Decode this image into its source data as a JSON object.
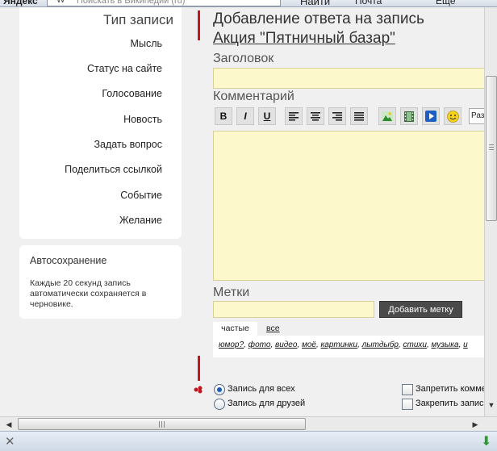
{
  "browser": {
    "logo": "Яндекс",
    "search_placeholder": "Поискать в Википедии (ru)",
    "find_label": "Найти",
    "mail_label": "Почта",
    "extra_label": "Ещё"
  },
  "sidebar": {
    "title": "Тип записи",
    "items": [
      {
        "label": "Мысль"
      },
      {
        "label": "Статус на сайте"
      },
      {
        "label": "Голосование"
      },
      {
        "label": "Новость"
      },
      {
        "label": "Задать вопрос"
      },
      {
        "label": "Поделиться ссылкой"
      },
      {
        "label": "Событие"
      },
      {
        "label": "Желание"
      }
    ]
  },
  "autosave": {
    "title": "Автосохранение",
    "description": "Каждые 20 секунд запись автоматически сохраняется в черновике."
  },
  "form": {
    "heading": "Добавление ответа на запись",
    "subheading": "Акция \"Пятничный базар\"",
    "title_label": "Заголовок",
    "title_value": "",
    "comment_label": "Комментарий",
    "comment_value": "",
    "format_select_value": "Разм",
    "toolbar": {
      "bold": "B",
      "italic": "I",
      "underline": "U"
    },
    "tags_label": "Метки",
    "tags_value": "",
    "add_tag_button": "Добавить метку",
    "tag_tabs": {
      "frequent": "частые",
      "all": "все"
    },
    "tag_cloud": [
      "юмор?",
      "фото",
      "видео",
      "моё",
      "картинки",
      "лытдыбр",
      "стихи",
      "музыка",
      "и"
    ]
  },
  "privacy": {
    "options": [
      {
        "label": "Запись для всех",
        "checked": true
      },
      {
        "label": "Запись для друзей",
        "checked": false
      }
    ],
    "checkboxes": [
      {
        "label": "Запретить комме",
        "checked": false
      },
      {
        "label": "Закрепить запис",
        "checked": false
      }
    ]
  },
  "colors": {
    "field_bg": "#fdf7cc",
    "marker_red": "#c4161c",
    "button_dark": "#4a4a4a"
  }
}
